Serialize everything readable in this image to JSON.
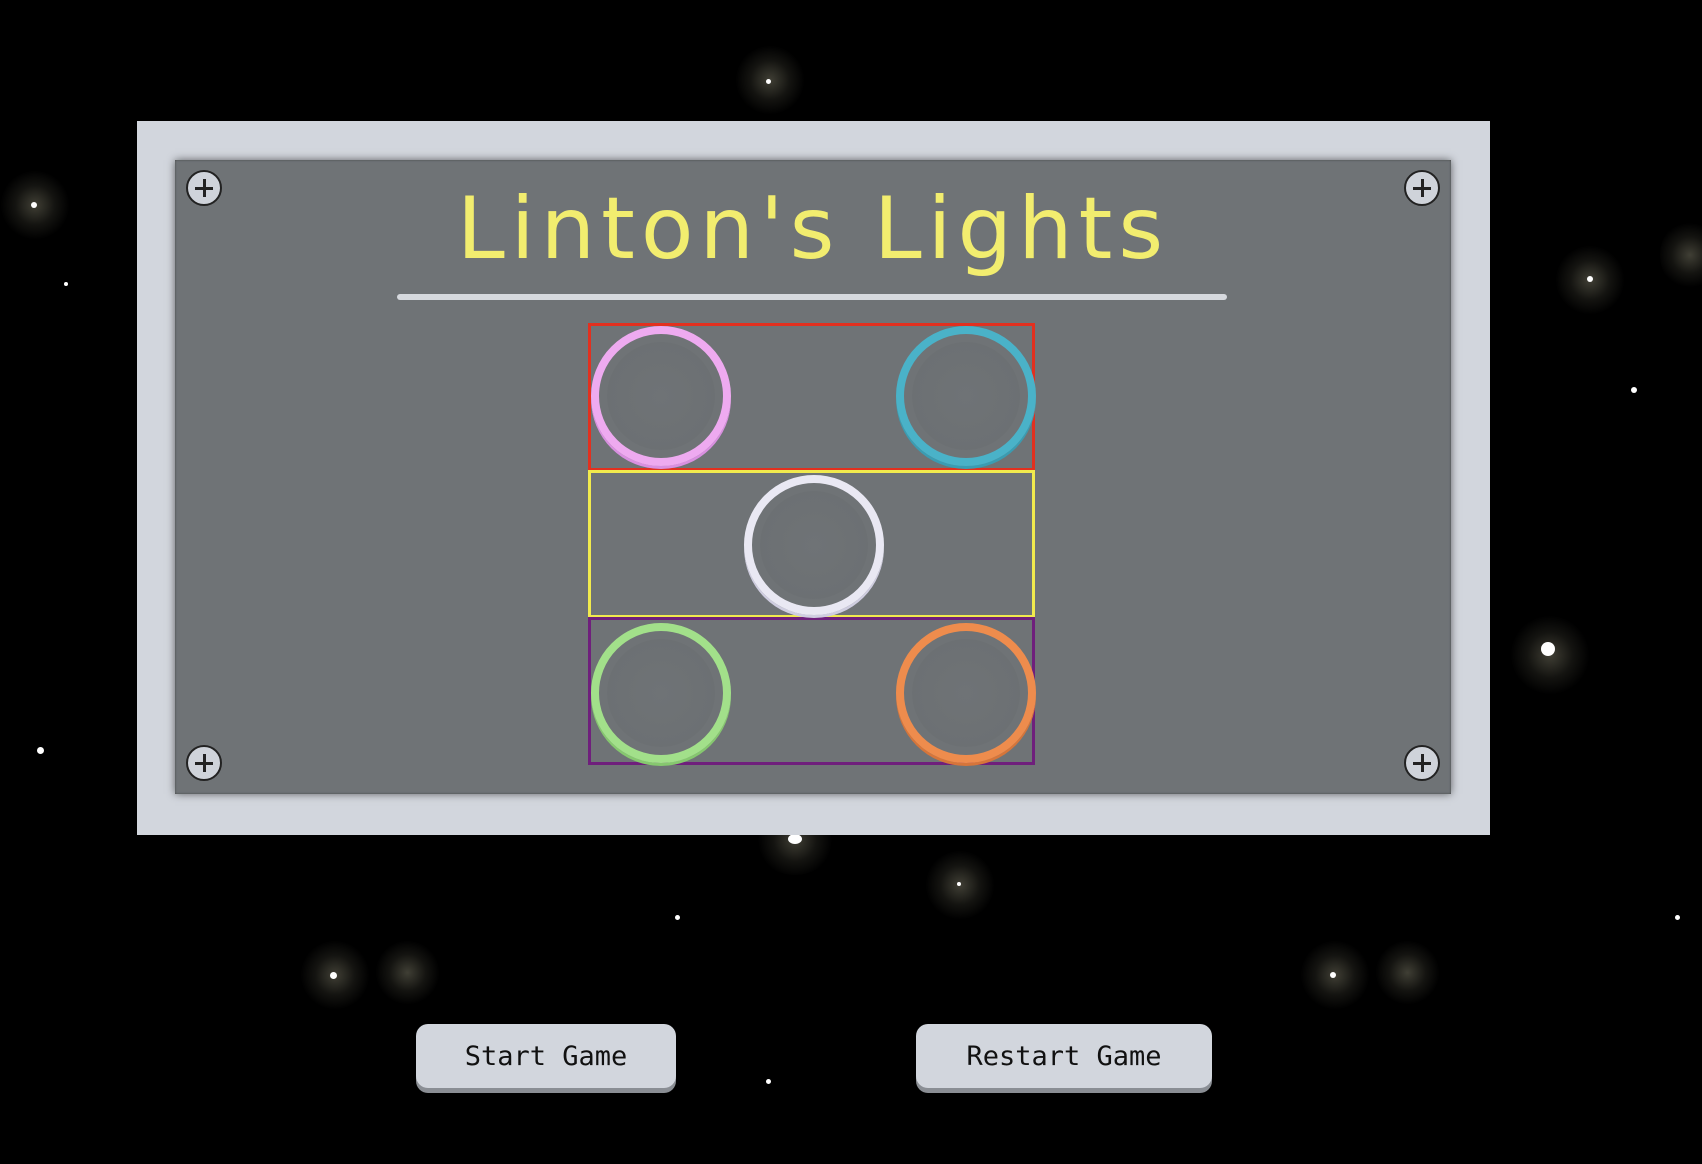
{
  "game": {
    "title": "Linton's Lights",
    "zones": [
      {
        "name": "top",
        "color": "#e2301f"
      },
      {
        "name": "middle",
        "color": "#f1ea4d"
      },
      {
        "name": "bottom",
        "color": "#6f1f7c"
      }
    ],
    "lights": [
      {
        "id": "pink",
        "color": "#eeaaf0"
      },
      {
        "id": "blue",
        "color": "#4ab2c8"
      },
      {
        "id": "white",
        "color": "#e9e8f3"
      },
      {
        "id": "green",
        "color": "#a2e08a"
      },
      {
        "id": "orange",
        "color": "#ee8c4d"
      }
    ]
  },
  "controls": {
    "start_label": "Start Game",
    "restart_label": "Restart Game"
  },
  "colors": {
    "background": "#000000",
    "frame": "#d2d6dd",
    "board": "#6f7376",
    "title": "#f2ed6f"
  }
}
